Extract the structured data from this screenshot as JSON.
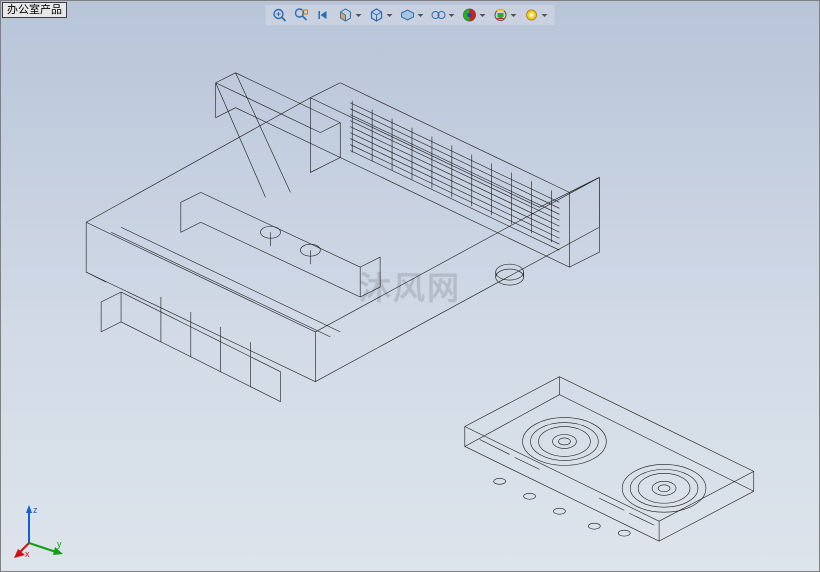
{
  "tag_label": "办公室产品",
  "watermark": "沐风网",
  "toolbar": {
    "items": [
      {
        "name": "zoom-to-fit-icon"
      },
      {
        "name": "zoom-area-icon"
      },
      {
        "name": "previous-view-icon"
      },
      {
        "name": "section-view-icon",
        "dropdown": true
      },
      {
        "name": "view-orientation-icon",
        "dropdown": true
      },
      {
        "name": "display-style-icon",
        "dropdown": true
      },
      {
        "name": "hide-show-icon",
        "dropdown": true
      },
      {
        "name": "appearance-icon",
        "dropdown": true
      },
      {
        "name": "scene-icon",
        "dropdown": true
      },
      {
        "name": "view-settings-icon",
        "dropdown": true
      }
    ]
  },
  "axes": {
    "x": "x",
    "y": "y",
    "z": "z"
  },
  "model": {
    "component_a": "cassette-recorder-body-wireframe",
    "component_b": "cassette-tape-wireframe"
  }
}
